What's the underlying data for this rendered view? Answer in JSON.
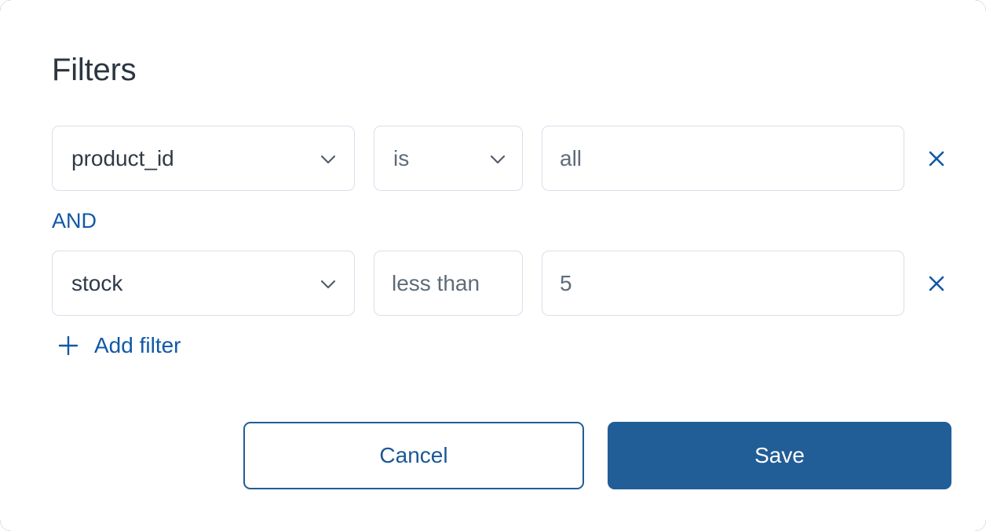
{
  "dialog": {
    "title": "Filters"
  },
  "filters": {
    "rows": [
      {
        "field": "product_id",
        "field_icon": "chevron-down-icon",
        "operator": "is",
        "operator_icon": "chevron-down-icon",
        "operator_has_chevron": true,
        "value": "all",
        "remove_icon": "close-icon"
      },
      {
        "field": "stock",
        "field_icon": "chevron-down-icon",
        "operator": "less than",
        "operator_icon": "",
        "operator_has_chevron": false,
        "value": "5",
        "remove_icon": "close-icon"
      }
    ],
    "conjunction": "AND",
    "add_filter": {
      "label": "Add filter",
      "icon": "plus-icon"
    }
  },
  "footer": {
    "cancel_label": "Cancel",
    "save_label": "Save"
  },
  "colors": {
    "accent_blue": "#215d96",
    "link_blue": "#1158a6",
    "text_dark": "#2e3a46",
    "text_muted": "#5f6b78",
    "border": "#d7e0ea",
    "surface": "#ffffff"
  }
}
